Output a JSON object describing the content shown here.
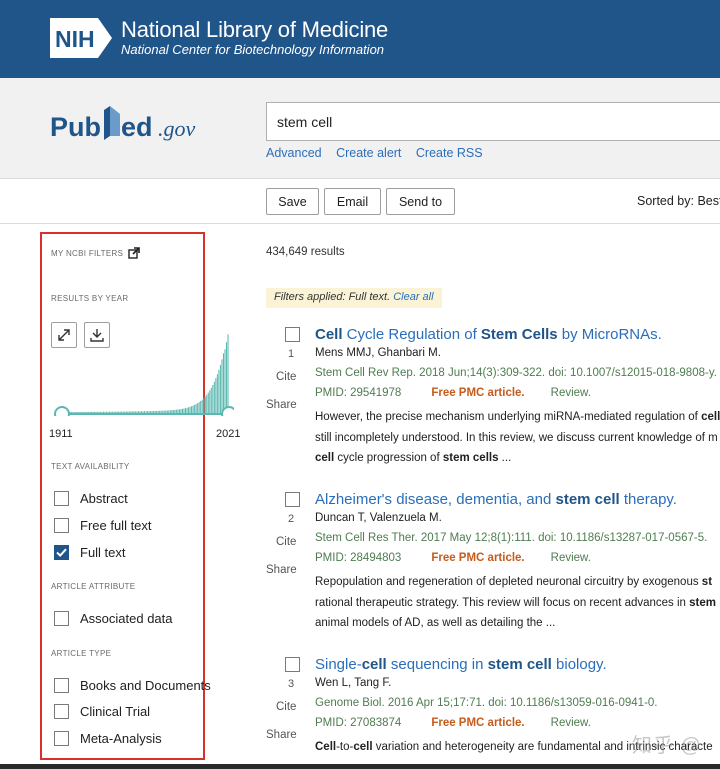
{
  "nih_banner": {
    "logo_text": "NIH",
    "title": "National Library of Medicine",
    "subtitle": "National Center for Biotechnology Information"
  },
  "header": {
    "logo_text": "PubMed.gov",
    "search_value": "stem cell",
    "links": [
      "Advanced",
      "Create alert",
      "Create RSS"
    ]
  },
  "toolbar": {
    "save_label": "Save",
    "email_label": "Email",
    "send_to_label": "Send to",
    "sorted_by": "Sorted by: Best m"
  },
  "sidebar": {
    "my_ncbi_filters": "MY NCBI FILTERS",
    "results_by_year": "RESULTS BY YEAR",
    "year_start": "1911",
    "year_end": "2021",
    "text_availability": "TEXT AVAILABILITY",
    "text_options": [
      {
        "label": "Abstract",
        "checked": false
      },
      {
        "label": "Free full text",
        "checked": false
      },
      {
        "label": "Full text",
        "checked": true
      }
    ],
    "article_attribute": "ARTICLE ATTRIBUTE",
    "attribute_options": [
      {
        "label": "Associated data",
        "checked": false
      }
    ],
    "article_type": "ARTICLE TYPE",
    "type_options": [
      {
        "label": "Books and Documents",
        "checked": false
      },
      {
        "label": "Clinical Trial",
        "checked": false
      },
      {
        "label": "Meta-Analysis",
        "checked": false
      }
    ]
  },
  "results": {
    "count": "434,649 results",
    "filters_applied": "Filters applied: Full text.",
    "clear_all": "Clear all",
    "cite_label": "Cite",
    "share_label": "Share",
    "free_pmc_label": "Free PMC article.",
    "review_label": "Review.",
    "items": [
      {
        "number": "1",
        "title_parts": [
          {
            "text": "Cell",
            "bold": true
          },
          {
            "text": " Cycle Regulation of ",
            "bold": false
          },
          {
            "text": "Stem Cells",
            "bold": true
          },
          {
            "text": " by MicroRNAs.",
            "bold": false
          }
        ],
        "authors": "Mens MMJ, Ghanbari M.",
        "citation": "Stem Cell Rev Rep. 2018 Jun;14(3):309-322. doi: 10.1007/s12015-018-9808-y.",
        "pmid": "PMID: 29541978",
        "snippet": [
          [
            {
              "text": "However, the precise mechanism underlying miRNA-mediated regulation of ",
              "bold": false
            },
            {
              "text": "cell",
              "bold": true
            }
          ],
          [
            {
              "text": "still incompletely understood. In this review, we discuss current knowledge of m",
              "bold": false
            }
          ],
          [
            {
              "text": "cell",
              "bold": true
            },
            {
              "text": " cycle progression of ",
              "bold": false
            },
            {
              "text": "stem cells",
              "bold": true
            },
            {
              "text": " ...",
              "bold": false
            }
          ]
        ]
      },
      {
        "number": "2",
        "title_parts": [
          {
            "text": "Alzheimer's disease, dementia, and ",
            "bold": false
          },
          {
            "text": "stem cell",
            "bold": true
          },
          {
            "text": " therapy.",
            "bold": false
          }
        ],
        "authors": "Duncan T, Valenzuela M.",
        "citation": "Stem Cell Res Ther. 2017 May 12;8(1):111. doi: 10.1186/s13287-017-0567-5.",
        "pmid": "PMID: 28494803",
        "snippet": [
          [
            {
              "text": "Repopulation and regeneration of depleted neuronal circuitry by exogenous ",
              "bold": false
            },
            {
              "text": "st",
              "bold": true
            }
          ],
          [
            {
              "text": "rational therapeutic strategy. This review will focus on recent advances in ",
              "bold": false
            },
            {
              "text": "stem",
              "bold": true
            }
          ],
          [
            {
              "text": "animal models of AD, as well as detailing the ...",
              "bold": false
            }
          ]
        ]
      },
      {
        "number": "3",
        "title_parts": [
          {
            "text": "Single-",
            "bold": false
          },
          {
            "text": "cell",
            "bold": true
          },
          {
            "text": " sequencing in ",
            "bold": false
          },
          {
            "text": "stem cell",
            "bold": true
          },
          {
            "text": " biology.",
            "bold": false
          }
        ],
        "authors": "Wen L, Tang F.",
        "citation": "Genome Biol. 2016 Apr 15;17:71. doi: 10.1186/s13059-016-0941-0.",
        "pmid": "PMID: 27083874",
        "snippet": [
          [
            {
              "text": "Cell",
              "bold": true
            },
            {
              "text": "-to-",
              "bold": false
            },
            {
              "text": "cell",
              "bold": true
            },
            {
              "text": " variation and heterogeneity are fundamental and intrinsic characte",
              "bold": false
            }
          ]
        ]
      }
    ]
  },
  "watermark": "知乎 @",
  "colors": {
    "nih_blue": "#20558a",
    "link_blue": "#2a6ebb",
    "journal_green": "#4f7c50",
    "free_orange": "#c65b1c",
    "highlight_red": "#d8312b",
    "histogram_teal": "#5bb8b0"
  }
}
